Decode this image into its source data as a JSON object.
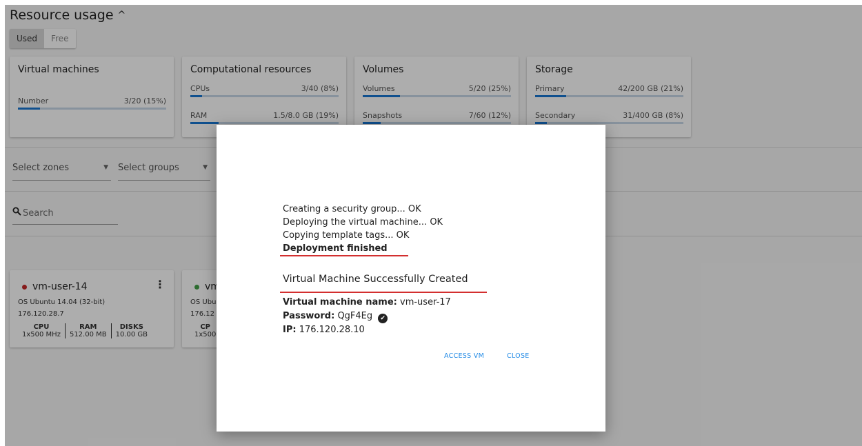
{
  "header": {
    "title": "Resource usage",
    "chevron": "chevron-up-icon"
  },
  "toggle": {
    "used": "Used",
    "free": "Free"
  },
  "cards": {
    "vms": {
      "title": "Virtual machines",
      "meters": [
        {
          "label": "Number",
          "value": "3/20 (15%)",
          "pct": 15
        }
      ]
    },
    "compute": {
      "title": "Computational resources",
      "meters": [
        {
          "label": "CPUs",
          "value": "3/40 (8%)",
          "pct": 8
        },
        {
          "label": "RAM",
          "value": "1.5/8.0 GB (19%)",
          "pct": 19
        }
      ]
    },
    "volumes": {
      "title": "Volumes",
      "meters": [
        {
          "label": "Volumes",
          "value": "5/20 (25%)",
          "pct": 25
        },
        {
          "label": "Snapshots",
          "value": "7/60 (12%)",
          "pct": 12
        }
      ]
    },
    "storage": {
      "title": "Storage",
      "meters": [
        {
          "label": "Primary",
          "value": "42/200 GB (21%)",
          "pct": 21
        },
        {
          "label": "Secondary",
          "value": "31/400 GB (8%)",
          "pct": 8
        }
      ]
    }
  },
  "filters": {
    "zones": "Select zones",
    "groups": "Select groups",
    "arrow": "▼"
  },
  "search": {
    "placeholder": "Search"
  },
  "vm_cards": [
    {
      "name": "vm-user-14",
      "status_color": "#c62828",
      "os": "OS Ubuntu 14.04 (32-bit)",
      "ip": "176.120.28.7",
      "cpu_h": "CPU",
      "cpu": "1x500 MHz",
      "ram_h": "RAM",
      "ram": "512.00 MB",
      "disks_h": "DISKS",
      "disks": "10.00 GB"
    },
    {
      "name": "vm",
      "status_color": "#43a047",
      "os": "OS Ubu",
      "ip": "176.12",
      "cpu_h": "CP",
      "cpu": "1x500"
    }
  ],
  "dialog": {
    "log": [
      "Creating a security group... OK",
      "Deploying the virtual machine... OK",
      "Copying template tags... OK"
    ],
    "finished": "Deployment finished",
    "success": "Virtual Machine Successfully Created",
    "vm_name_label": "Virtual machine name:",
    "vm_name": "vm-user-17",
    "password_label": "Password:",
    "password": "QgF4Eg",
    "ip_label": "IP:",
    "ip": "176.120.28.10",
    "access": "ACCESS VM",
    "close": "CLOSE"
  }
}
